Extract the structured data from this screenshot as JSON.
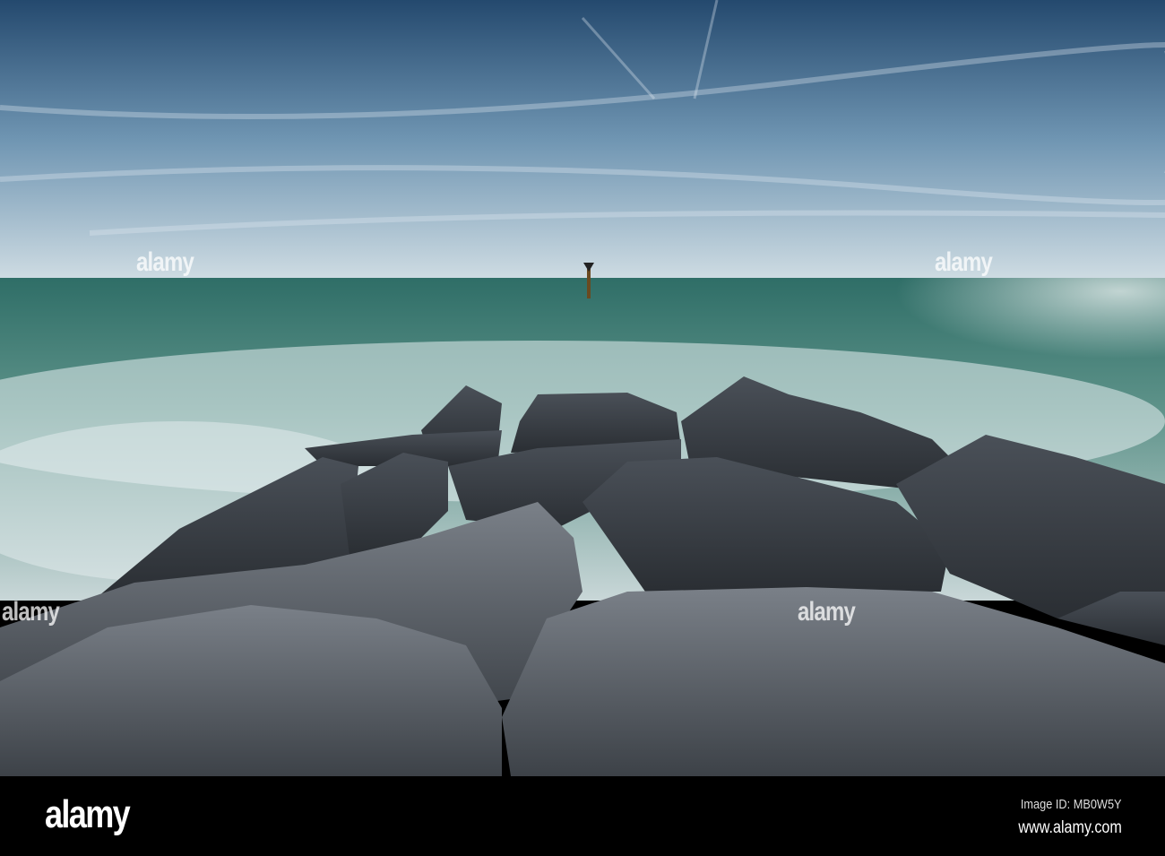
{
  "photo": {
    "subject": "rock-groyne-seascape",
    "colors": {
      "sky_top": "#2a5378",
      "sky_horizon": "#c8d8e0",
      "sea": "#3f7a72",
      "foam": "#dfe8ea",
      "rock": "#3a3f46"
    }
  },
  "watermark": {
    "text": "alamy"
  },
  "footer": {
    "logo": "alamy",
    "image_id": "Image ID: MB0W5Y",
    "url": "www.alamy.com"
  }
}
